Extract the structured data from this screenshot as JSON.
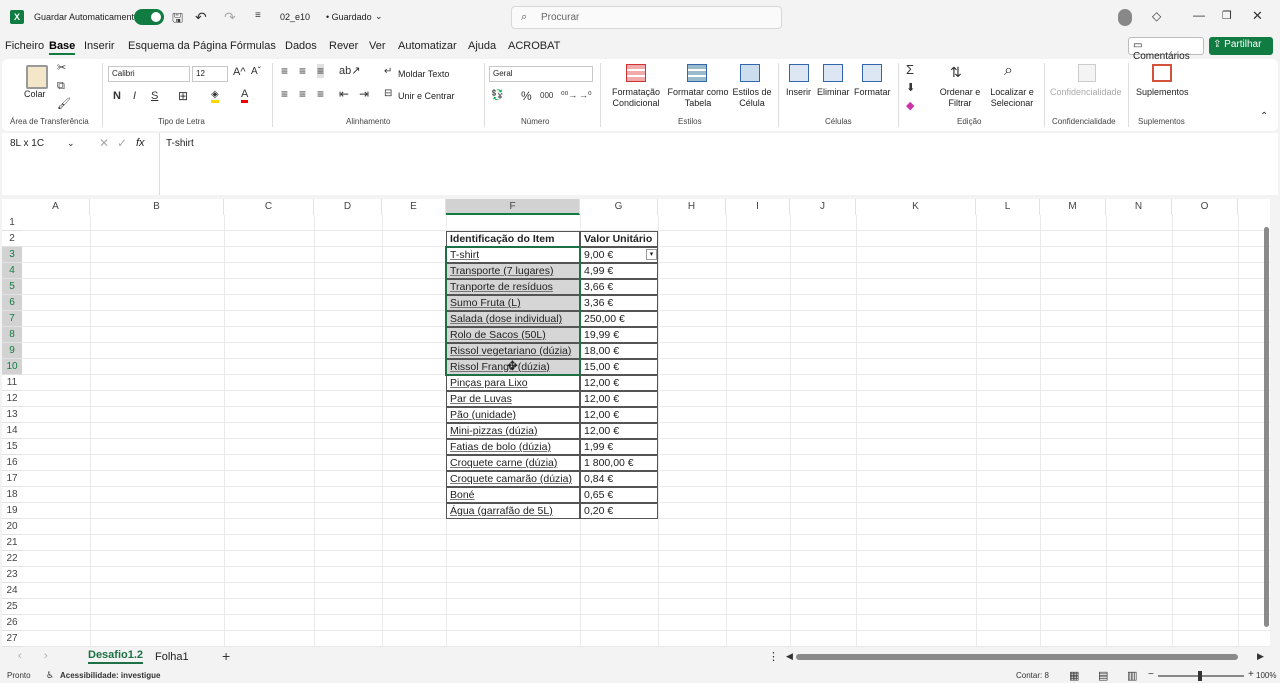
{
  "titlebar": {
    "autosave_label": "Guardar Automaticamente",
    "autosave_on": "true",
    "filename": "02_e10",
    "save_status": "• Guardado",
    "search_placeholder": "Procurar"
  },
  "menu": [
    "Ficheiro",
    "Base",
    "Inserir",
    "Esquema da Página",
    "Fórmulas",
    "Dados",
    "Rever",
    "Ver",
    "Automatizar",
    "Ajuda",
    "ACROBAT"
  ],
  "menu_active": "Base",
  "comments_label": "Comentários",
  "share_label": "Partilhar",
  "ribbon": {
    "paste_label": "Colar",
    "clipboard_label": "Área de Transferência",
    "font_name": "Calibri",
    "font_size": "12",
    "font_label": "Tipo de Letra",
    "bold": "N",
    "italic": "I",
    "underline": "S",
    "wrap_label": "Moldar Texto",
    "merge_label": "Unir e Centrar",
    "align_label": "Alinhamento",
    "number_format": "Geral",
    "number_label": "Número",
    "cond_format": "Formatação Condicional",
    "format_table": "Formatar como Tabela",
    "cell_styles": "Estilos de Célula",
    "styles_label": "Estilos",
    "insert": "Inserir",
    "delete": "Eliminar",
    "format": "Formatar",
    "cells_label": "Células",
    "sort_filter": "Ordenar e Filtrar",
    "find_select": "Localizar e Selecionar",
    "editing_label": "Edição",
    "confidentiality": "Confidencialidade",
    "confidentiality_label": "Confidencialidade",
    "addins": "Suplementos",
    "addins_label": "Suplementos"
  },
  "formula": {
    "namebox": "8L x 1C",
    "fx": "fx",
    "value": "T-shirt"
  },
  "columns": [
    "A",
    "B",
    "C",
    "D",
    "E",
    "F",
    "G",
    "H",
    "I",
    "J",
    "K",
    "L",
    "M",
    "N",
    "O"
  ],
  "rows": [
    "1",
    "2",
    "3",
    "4",
    "5",
    "6",
    "7",
    "8",
    "9",
    "10",
    "11",
    "12",
    "13",
    "14",
    "15",
    "16",
    "17",
    "18",
    "19",
    "20",
    "21",
    "22",
    "23",
    "24",
    "25",
    "26",
    "27"
  ],
  "table": {
    "header_item": "Identificação do Item",
    "header_value": "Valor Unitário",
    "items": [
      {
        "name": "T-shirt",
        "value": "9,00 €"
      },
      {
        "name": "Transporte (7 lugares)",
        "value": "4,99 €"
      },
      {
        "name": "Tranporte de resíduos",
        "value": "3,66 €"
      },
      {
        "name": "Sumo Fruta (L)",
        "value": "3,36 €"
      },
      {
        "name": "Salada (dose individual)",
        "value": "250,00 €"
      },
      {
        "name": "Rolo de Sacos (50L)",
        "value": "19,99 €"
      },
      {
        "name": "Rissol vegetariano (dúzia)",
        "value": "18,00 €"
      },
      {
        "name": "Rissol Frango (dúzia)",
        "value": "15,00 €"
      },
      {
        "name": "Pinças para Lixo",
        "value": "12,00 €"
      },
      {
        "name": "Par de Luvas",
        "value": "12,00 €"
      },
      {
        "name": "Pão (unidade)",
        "value": "12,00 €"
      },
      {
        "name": "Mini-pizzas (dúzia)",
        "value": "12,00 €"
      },
      {
        "name": "Fatias de bolo (dúzia)",
        "value": "1,99 €"
      },
      {
        "name": "Croquete carne (dúzia)",
        "value": "1 800,00 €"
      },
      {
        "name": "Croquete camarão (dúzia)",
        "value": "0,84 €"
      },
      {
        "name": "Boné",
        "value": "0,65 €"
      },
      {
        "name": "Água (garrafão de 5L)",
        "value": "0,20 €"
      }
    ]
  },
  "sheets": [
    "Desafio1.2",
    "Folha1"
  ],
  "active_sheet": "Desafio1.2",
  "status": {
    "ready": "Pronto",
    "accessibility": "Acessibilidade: investigue",
    "count": "Contar: 8",
    "zoom": "100%"
  },
  "colors": {
    "excel_green": "#107c41",
    "selection": "#d6d6d6",
    "accent": "#1e7145"
  }
}
